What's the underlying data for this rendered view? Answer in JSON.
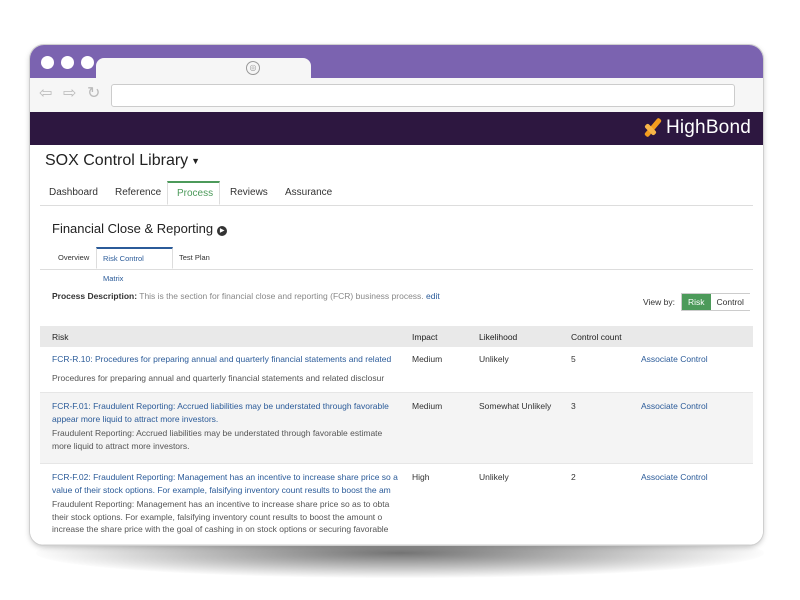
{
  "browser": {
    "window_dots": 3,
    "tab_icon": "globe-icon"
  },
  "brand": {
    "name": "HighBond",
    "colors": {
      "orange": "#f39c1e",
      "purple_bar": "#2d1740",
      "frame": "#7b63b0"
    }
  },
  "app": {
    "library_title": "SOX Control Library",
    "main_nav": [
      "Dashboard",
      "Reference",
      "Process",
      "Reviews",
      "Assurance"
    ],
    "main_nav_active": "Process",
    "process_title": "Financial Close & Reporting",
    "sub_nav": [
      "Overview",
      "Risk Control Matrix",
      "Test Plan"
    ],
    "sub_nav_active": "Risk Control Matrix",
    "description": {
      "label": "Process Description:",
      "text": "This is the section for financial close and reporting (FCR) business process.",
      "edit": "edit"
    },
    "view_by": {
      "label": "View by:",
      "options": [
        "Risk",
        "Control"
      ],
      "selected": "Risk"
    }
  },
  "table": {
    "headers": [
      "Risk",
      "Impact",
      "Likelihood",
      "Control count",
      ""
    ],
    "rows": [
      {
        "title_lines": [
          "FCR-R.10: Procedures for preparing annual and quarterly financial statements and related"
        ],
        "desc_lines": [
          "Procedures for preparing annual and quarterly financial statements and related disclosur"
        ],
        "impact": "Medium",
        "likelihood": "Unlikely",
        "count": "5",
        "action": "Associate Control"
      },
      {
        "title_lines": [
          "FCR-F.01: Fraudulent Reporting: Accrued liabilities may be understated through favorable",
          "appear more liquid to attract more investors."
        ],
        "desc_lines": [
          "Fraudulent Reporting: Accrued liabilities may be understated through favorable estimate",
          "more liquid to attract more investors."
        ],
        "impact": "Medium",
        "likelihood": "Somewhat Unlikely",
        "count": "3",
        "action": "Associate Control"
      },
      {
        "title_lines": [
          "FCR-F.02: Fraudulent Reporting: Management has an incentive to increase share price so a",
          "value of their stock options. For example, falsifying inventory count results to boost the am"
        ],
        "desc_lines": [
          "Fraudulent Reporting: Management has an incentive to increase share price so as to obta",
          "their stock options. For example, falsifying inventory count results to boost the amount o",
          "increase the share price with the goal of cashing in on stock options or securing favorable"
        ],
        "impact": "High",
        "likelihood": "Unlikely",
        "count": "2",
        "action": "Associate Control"
      }
    ]
  }
}
